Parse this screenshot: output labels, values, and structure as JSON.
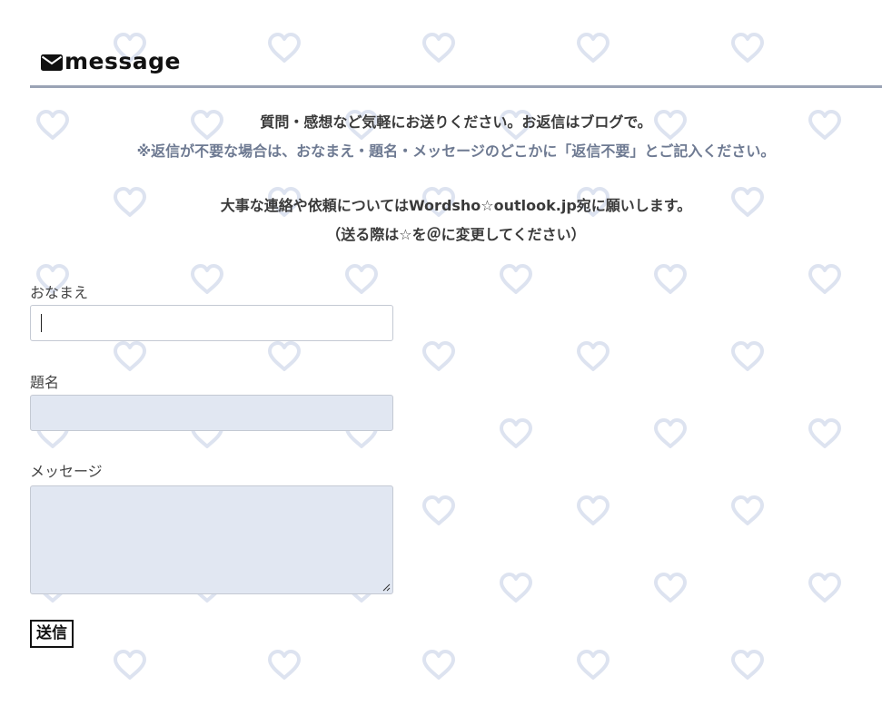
{
  "header": {
    "title": "message",
    "icon": "envelope-icon"
  },
  "notices": {
    "line1": "質問・感想など気軽にお送りください。お返信はブログで。",
    "line2": "※返信が不要な場合は、おなまえ・題名・メッセージのどこかに「返信不要」とご記入ください。",
    "line3": "大事な連絡や依頼についてはWordsho☆outlook.jp宛に願いします。",
    "line4": "（送る際は☆を＠に変更してください）"
  },
  "form": {
    "name_label": "おなまえ",
    "name_value": "",
    "subject_label": "題名",
    "subject_value": "",
    "message_label": "メッセージ",
    "message_value": "",
    "submit_label": "送信"
  },
  "colors": {
    "background_hearts": "#dde3f0",
    "header_rule": "#9aa3b5",
    "muted_text": "#6e7a92",
    "input_fill": "#e1e7f2"
  }
}
